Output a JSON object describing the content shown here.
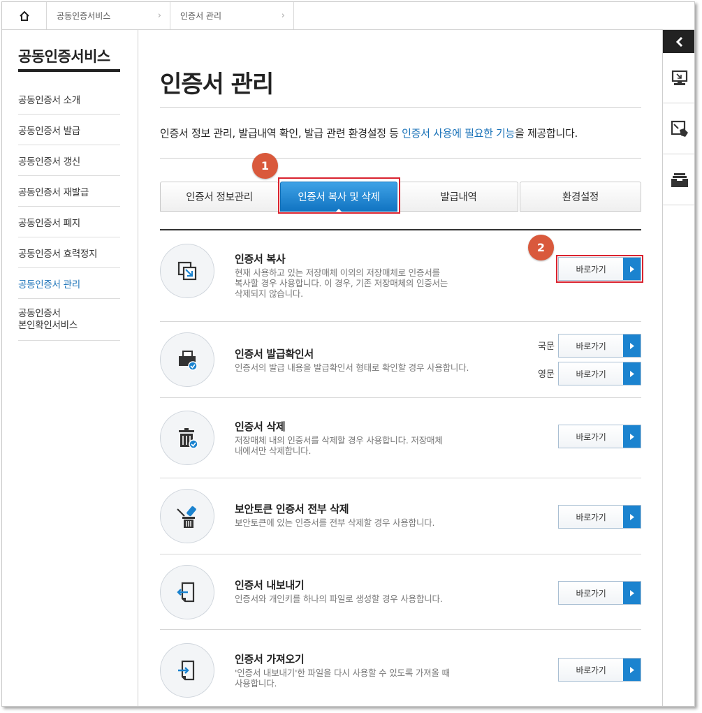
{
  "breadcrumb": {
    "home_icon": "home-icon",
    "items": [
      "공동인증서비스",
      "인증서 관리"
    ]
  },
  "sidebar": {
    "title": "공동인증서비스",
    "items": [
      {
        "label": "공동인증서 소개"
      },
      {
        "label": "공동인증서 발급"
      },
      {
        "label": "공동인증서 갱신"
      },
      {
        "label": "공동인증서 재발급"
      },
      {
        "label": "공동인증서 폐지"
      },
      {
        "label": "공동인증서 효력정지"
      },
      {
        "label": "공동인증서 관리",
        "active": true
      },
      {
        "label_line1": "공동인증서",
        "label_line2": "본인확인서비스"
      }
    ]
  },
  "main": {
    "title": "인증서 관리",
    "intro_before": "인증서 정보 관리, 발급내역 확인, 발급 관련 환경설정 등 ",
    "intro_highlight": "인증서 사용에 필요한 기능",
    "intro_after": "을 제공합니다.",
    "tabs": [
      {
        "label": "인증서 정보관리"
      },
      {
        "label": "인증서 복사 및 삭제",
        "active": true
      },
      {
        "label": "발급내역"
      },
      {
        "label": "환경설정"
      }
    ],
    "callouts": [
      "1",
      "2"
    ],
    "rows": [
      {
        "title": "인증서 복사",
        "desc": [
          "현재 사용하고 있는 저장매체 이외의 저장매체로 인증서를",
          "복사할 경우 사용합니다. 이 경우, 기존 저장매체의 인증서는",
          "삭제되지 않습니다."
        ],
        "button": "바로가기",
        "icon": "certificate-copy-icon"
      },
      {
        "title": "인증서 발급확인서",
        "desc": [
          "인증서의 발급 내용을 발급확인서 형태로 확인할 경우 사용합니다."
        ],
        "buttons": [
          {
            "lang": "국문",
            "label": "바로가기"
          },
          {
            "lang": "영문",
            "label": "바로가기"
          }
        ],
        "icon": "printer-check-icon"
      },
      {
        "title": "인증서 삭제",
        "desc": [
          "저장매체 내의 인증서를 삭제할 경우 사용합니다. 저장매체",
          "내에서만 삭제합니다."
        ],
        "button": "바로가기",
        "icon": "trash-check-icon"
      },
      {
        "title": "보안토큰 인증서 전부 삭제",
        "desc": [
          "보안토큰에 있는 인증서를 전부 삭제할 경우 사용합니다."
        ],
        "button": "바로가기",
        "icon": "token-trash-icon"
      },
      {
        "title": "인증서 내보내기",
        "desc": [
          "인증서와 개인키를 하나의 파일로 생성할 경우 사용합니다."
        ],
        "button": "바로가기",
        "icon": "export-file-icon"
      },
      {
        "title": "인증서 가져오기",
        "desc": [
          "'인증서 내보내기'한 파일을 다시 사용할 수 있도록 가져올 때",
          "사용합니다."
        ],
        "button": "바로가기",
        "icon": "import-file-icon"
      }
    ]
  },
  "quickbar": {
    "toggle_icon": "chevron-left-icon",
    "items": [
      "monitor-icon",
      "remote-support-icon",
      "inbox-icon"
    ]
  },
  "colors": {
    "accent_blue": "#1b83cf",
    "highlight_red": "#d9232f",
    "callout_orange": "#d9593c"
  }
}
